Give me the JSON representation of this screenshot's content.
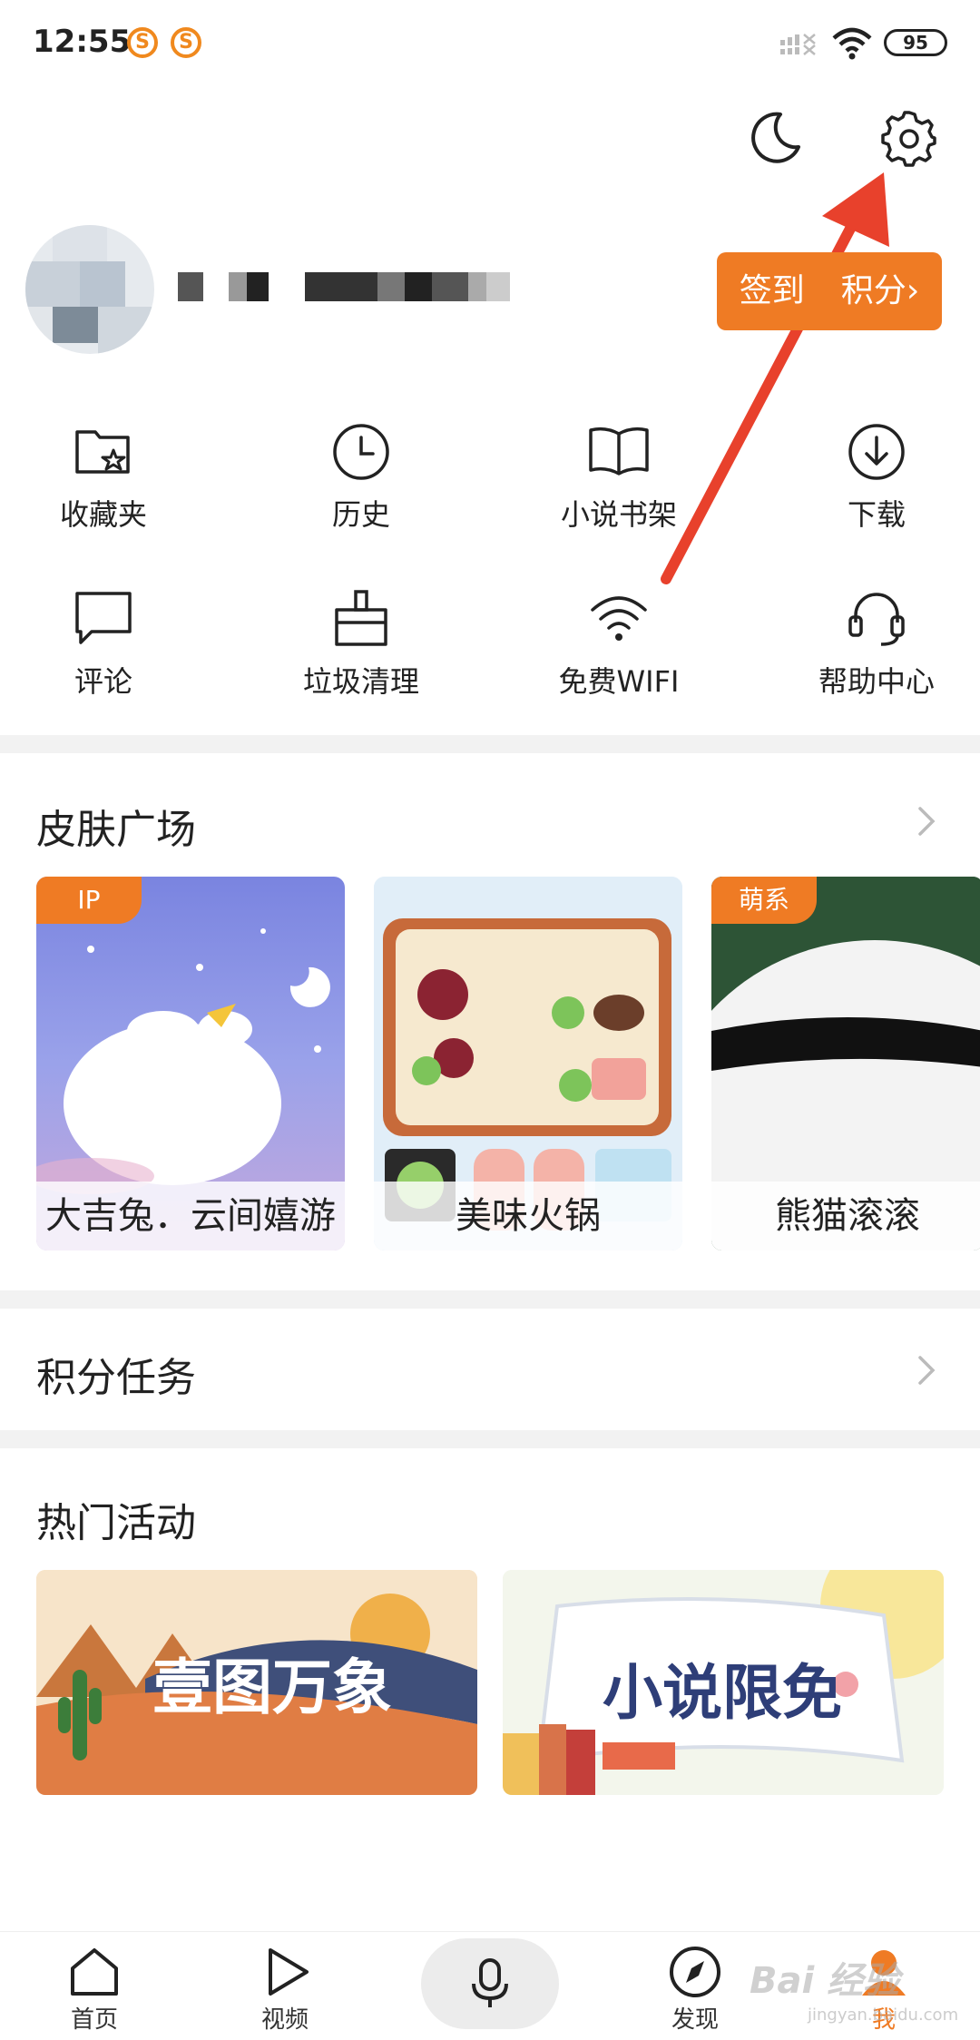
{
  "status_bar": {
    "time": "12:55",
    "app_icon_letter": "S",
    "battery": "95"
  },
  "header": {
    "moon_icon": "moon-icon",
    "settings_icon": "gear-icon"
  },
  "profile": {
    "checkin_label": "签到赚积分",
    "checkin_label_visible": "签到",
    "checkin_label_visible_2": "积分",
    "chevron": "›"
  },
  "quick_actions": [
    {
      "label": "收藏夹",
      "icon": "folder-star-icon"
    },
    {
      "label": "历史",
      "icon": "clock-icon"
    },
    {
      "label": "小说书架",
      "icon": "book-icon"
    },
    {
      "label": "下载",
      "icon": "download-icon"
    },
    {
      "label": "评论",
      "icon": "comment-icon"
    },
    {
      "label": "垃圾清理",
      "icon": "broom-icon"
    },
    {
      "label": "免费WIFI",
      "icon": "wifi-icon"
    },
    {
      "label": "帮助中心",
      "icon": "headset-icon"
    }
  ],
  "skins": {
    "title": "皮肤广场",
    "items": [
      {
        "tag": "IP",
        "caption": "大吉兔．云间嬉游"
      },
      {
        "tag": "",
        "caption": "美味火锅"
      },
      {
        "tag": "萌系",
        "caption": "熊猫滚滚"
      }
    ]
  },
  "points": {
    "title": "积分任务"
  },
  "activities": {
    "title": "热门活动",
    "items": [
      {
        "text": "壹图万象"
      },
      {
        "text": "小说限免"
      }
    ]
  },
  "bottom_nav": {
    "items": [
      {
        "label": "首页",
        "icon": "home-icon"
      },
      {
        "label": "视频",
        "icon": "play-icon"
      },
      {
        "label": "",
        "icon": "mic-icon"
      },
      {
        "label": "发现",
        "icon": "compass-icon"
      },
      {
        "label": "我",
        "icon": "me-icon"
      }
    ],
    "watermark": "Bai 经验",
    "watermark_url": "jingyan.baidu.com"
  },
  "colors": {
    "accent": "#ef7b24",
    "arrow": "#e8412c"
  }
}
